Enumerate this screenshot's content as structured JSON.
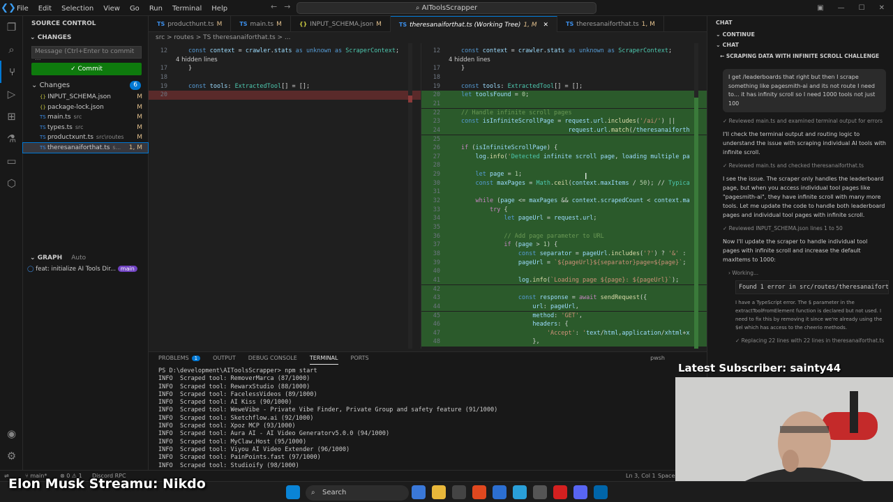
{
  "window": {
    "menu": [
      "File",
      "Edit",
      "Selection",
      "View",
      "Go",
      "Run",
      "Terminal",
      "Help"
    ],
    "search": "AIToolsScrapper"
  },
  "source_control": {
    "title": "SOURCE CONTROL",
    "changes_header": "CHANGES",
    "message_placeholder": "Message (Ctrl+Enter to commit ...",
    "commit_label": "Commit",
    "changes_label": "Changes",
    "changes_count": "6",
    "files": [
      {
        "name": "INPUT_SCHEMA.json",
        "path": "",
        "status": "M"
      },
      {
        "name": "package-lock.json",
        "path": "",
        "status": "M"
      },
      {
        "name": "main.ts",
        "path": "src",
        "status": "M"
      },
      {
        "name": "types.ts",
        "path": "src",
        "status": "M"
      },
      {
        "name": "productхunt.ts",
        "path": "src\\routes",
        "status": "M"
      },
      {
        "name": "theresanaiforthat.ts",
        "path": "s...",
        "status": "1, M"
      }
    ],
    "graph_label": "GRAPH",
    "graph_auto": "Auto",
    "commit_message": "feat: initialize AI Tools Dir...",
    "branch": "main"
  },
  "tabs": [
    {
      "label": "producthunt.ts",
      "status": "M",
      "active": false
    },
    {
      "label": "main.ts",
      "status": "M",
      "active": false
    },
    {
      "label": "INPUT_SCHEMA.json",
      "status": "M",
      "active": false
    },
    {
      "label": "theresanaiforthat.ts (Working Tree)",
      "status": "1, M",
      "active": true
    },
    {
      "label": "theresanaiforthat.ts",
      "status": "1, M",
      "active": false
    }
  ],
  "breadcrumb": "src > routes > TS theresanaiforthat.ts > ...",
  "diff_left": {
    "lines": [
      {
        "n": "12",
        "code": "const context = crawler.stats as unknown as ScraperContext;"
      },
      {
        "n": "",
        "code": "4 hidden lines"
      },
      {
        "n": "17",
        "code": "}"
      },
      {
        "n": "18",
        "code": ""
      },
      {
        "n": "19",
        "code": "const tools: ExtractedTool[] = [];"
      },
      {
        "n": "20",
        "code": ""
      }
    ]
  },
  "diff_right": {
    "lines": [
      {
        "n": "12",
        "code": "const context = crawler.stats as unknown as ScraperContext;"
      },
      {
        "n": "",
        "code": "4 hidden lines"
      },
      {
        "n": "17",
        "code": "}"
      },
      {
        "n": "18",
        "code": ""
      },
      {
        "n": "19",
        "code": "const tools: ExtractedTool[] = [];"
      },
      {
        "n": "20",
        "code": "let toolsFound = 0;"
      },
      {
        "n": "21",
        "code": ""
      },
      {
        "n": "22",
        "code": "// Handle infinite scroll pages"
      },
      {
        "n": "23",
        "code": "const isInfiniteScrollPage = request.url.includes('/ai/') ||"
      },
      {
        "n": "24",
        "code": "                              request.url.match(/theresanaiforth"
      },
      {
        "n": "25",
        "code": ""
      },
      {
        "n": "26",
        "code": "if (isInfiniteScrollPage) {"
      },
      {
        "n": "27",
        "code": "    log.info('Detected infinite scroll page, loading multiple pa"
      },
      {
        "n": "28",
        "code": ""
      },
      {
        "n": "29",
        "code": "    let page = 1;"
      },
      {
        "n": "30",
        "code": "    const maxPages = Math.ceil(context.maxItems / 50); // Typica"
      },
      {
        "n": "31",
        "code": ""
      },
      {
        "n": "32",
        "code": "    while (page <= maxPages && context.scrapedCount < context.ma"
      },
      {
        "n": "33",
        "code": "        try {"
      },
      {
        "n": "34",
        "code": "            let pageUrl = request.url;"
      },
      {
        "n": "35",
        "code": ""
      },
      {
        "n": "36",
        "code": "            // Add page parameter to URL"
      },
      {
        "n": "37",
        "code": "            if (page > 1) {"
      },
      {
        "n": "38",
        "code": "                const separator = pageUrl.includes('?') ? '&' :"
      },
      {
        "n": "39",
        "code": "                pageUrl = `${pageUrl}${separator}page=${page}`;"
      },
      {
        "n": "40",
        "code": ""
      },
      {
        "n": "41",
        "code": "                log.info(`Loading page ${page}: ${pageUrl}`);"
      },
      {
        "n": "42",
        "code": ""
      },
      {
        "n": "43",
        "code": "                const response = await sendRequest({"
      },
      {
        "n": "44",
        "code": "                    url: pageUrl,"
      },
      {
        "n": "45",
        "code": "                    method: 'GET',"
      },
      {
        "n": "46",
        "code": "                    headers: {"
      },
      {
        "n": "47",
        "code": "                        'Accept': 'text/html,application/xhtml+x"
      },
      {
        "n": "48",
        "code": "                    },"
      }
    ]
  },
  "panel": {
    "tabs": [
      "PROBLEMS",
      "OUTPUT",
      "DEBUG CONSOLE",
      "TERMINAL",
      "PORTS"
    ],
    "problems_count": "1",
    "active_tab": "TERMINAL",
    "shell": "pwsh",
    "prompt": "PS D:\\development\\AIToolsScrapper> npm start",
    "lines": [
      "INFO  Scraped tool: RemoverMarca (87/1000)",
      "INFO  Scraped tool: RewarxStudio (88/1000)",
      "INFO  Scraped tool: FacelessVideos (89/1000)",
      "INFO  Scraped tool: AI Kiss (90/1000)",
      "INFO  Scraped tool: WeweVibe - Private Vibe Finder, Private Group and safety feature (91/1000)",
      "INFO  Scraped tool: Sketchflow.ai (92/1000)",
      "INFO  Scraped tool: Xpoz MCP (93/1000)",
      "INFO  Scraped tool: Aura AI - AI Video Generatorv5.0.0 (94/1000)",
      "INFO  Scraped tool: MyClaw.Host (95/1000)",
      "INFO  Scraped tool: Viyou AI Video Extender (96/1000)",
      "INFO  Scraped tool: PainPoints.fast (97/1000)",
      "INFO  Scraped tool: Studioify (98/1000)"
    ]
  },
  "chat": {
    "header": "CHAT",
    "continue": "CONTINUE",
    "chat_label": "CHAT",
    "title": "SCRAPING DATA WITH INFINITE SCROLL CHALLENGE",
    "user_message": "I get /leaderboards that right but then I scrape something like pagesmith-ai and its not route I need to... it has infinity scroll so I need 1000 tools not just 100",
    "note1": "Reviewed main.ts and examined terminal output for errors",
    "text1": "I'll check the terminal output and routing logic to understand the issue with scraping individual AI tools with infinite scroll.",
    "note2": "Reviewed main.ts and checked theresanaiforthat.ts",
    "text2": "I see the issue. The scraper only handles the leaderboard page, but when you access individual tool pages like \"pagesmith-ai\", they have infinite scroll with many more tools. Let me update the code to handle both leaderboard pages and individual tool pages with infinite scroll.",
    "note3": "Reviewed INPUT_SCHEMA.json lines 1 to 50",
    "text3": "Now I'll update the scraper to handle individual tool pages with infinite scroll and increase the default maxItems to 1000:",
    "working": "Working...",
    "code_snippet": "Found 1 error in src/routes/theresanaiforthat",
    "small1": "I have a TypeScript error. The $ parameter in the extractToolFromElement function is declared but not used. I need to fix this by removing it since we're already using the $el which has access to the cheerio methods.",
    "small2": "Replacing 22 lines with 22 lines in theresanaiforthat.ts"
  },
  "statusbar": {
    "branch": "main*",
    "errors": "0",
    "warnings": "1",
    "discord": "Discord RPC",
    "position": "Ln 3, Col 1",
    "spaces": "Spaces"
  },
  "taskbar": {
    "search": "Search"
  },
  "overlay": {
    "subscriber": "Latest Subscriber: sainty44",
    "streamer": "Elon Musk Streamu: Nikdo"
  }
}
